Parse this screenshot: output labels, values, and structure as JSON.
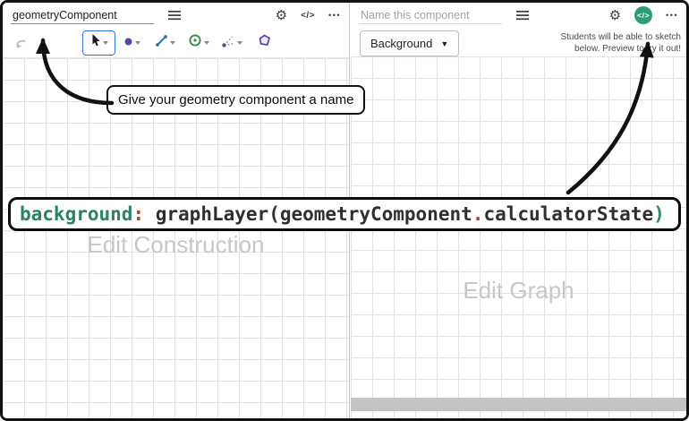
{
  "icons": {
    "gear": "⚙",
    "code": "</>",
    "ellipsis": "•••",
    "dropdown_triangle": "▼"
  },
  "colors": {
    "accent_teal": "#2d9d78",
    "selected_tool_border": "#2f72dc",
    "code_keyword": "#2b8066",
    "code_operator": "#bf3a2b",
    "code_plain": "#2f2f2f",
    "code_paren": "#2e8b57",
    "grid_line": "#dfe3e8",
    "watermark_gray": "#c7c7c7",
    "scrollbar_gray": "#c3c3c3"
  },
  "left_panel": {
    "name_input_value": "geometryComponent",
    "watermark": "Edit Construction"
  },
  "right_panel": {
    "name_input_placeholder": "Name this component",
    "background_button_label": "Background",
    "students_note_line1": "Students will be able to sketch",
    "students_note_line2": "below. Preview to try it out!",
    "watermark": "Edit Graph"
  },
  "callout": {
    "text": "Give your geometry component a name"
  },
  "code_overlay": {
    "tokens": [
      {
        "text": "background",
        "type": "keyword"
      },
      {
        "text": ":",
        "type": "operator"
      },
      {
        "text": " ",
        "type": "plain"
      },
      {
        "text": "graphLayer",
        "type": "plain"
      },
      {
        "text": "(",
        "type": "plain"
      },
      {
        "text": "geometryComponent",
        "type": "plain"
      },
      {
        "text": ".",
        "type": "operator"
      },
      {
        "text": "calculatorState",
        "type": "plain"
      },
      {
        "text": ")",
        "type": "paren"
      }
    ]
  }
}
